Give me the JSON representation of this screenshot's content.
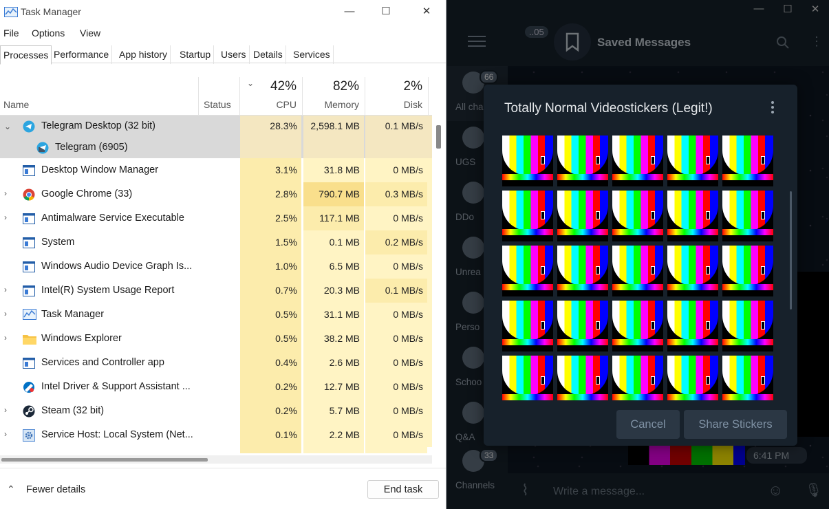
{
  "task_manager": {
    "title": "Task Manager",
    "window_buttons": [
      "—",
      "☐",
      "✕"
    ],
    "menu": [
      "File",
      "Options",
      "View"
    ],
    "tabs": [
      "Processes",
      "Performance",
      "App history",
      "Startup",
      "Users",
      "Details",
      "Services"
    ],
    "columns": {
      "name": "Name",
      "status": "Status",
      "cpu_pct": "42%",
      "cpu": "CPU",
      "mem_pct": "82%",
      "mem": "Memory",
      "disk_pct": "2%",
      "disk": "Disk"
    },
    "rows": [
      {
        "name": "Telegram Desktop (32 bit)",
        "cpu": "28.3%",
        "mem": "2,598.1 MB",
        "disk": "0.1 MB/s",
        "expand": "⌄",
        "icon": "telegram-icon"
      },
      {
        "name": "Telegram (6905)",
        "cpu": "",
        "mem": "",
        "disk": "",
        "expand": "",
        "icon": "telegram-child-icon"
      },
      {
        "name": "Desktop Window Manager",
        "cpu": "3.1%",
        "mem": "31.8 MB",
        "disk": "0 MB/s",
        "expand": "",
        "icon": "app-window-icon"
      },
      {
        "name": "Google Chrome (33)",
        "cpu": "2.8%",
        "mem": "790.7 MB",
        "disk": "0.3 MB/s",
        "expand": "›",
        "icon": "chrome-icon"
      },
      {
        "name": "Antimalware Service Executable",
        "cpu": "2.5%",
        "mem": "117.1 MB",
        "disk": "0 MB/s",
        "expand": "›",
        "icon": "app-window-icon"
      },
      {
        "name": "System",
        "cpu": "1.5%",
        "mem": "0.1 MB",
        "disk": "0.2 MB/s",
        "expand": "",
        "icon": "app-window-icon"
      },
      {
        "name": "Windows Audio Device Graph Is...",
        "cpu": "1.0%",
        "mem": "6.5 MB",
        "disk": "0 MB/s",
        "expand": "",
        "icon": "app-window-icon"
      },
      {
        "name": "Intel(R) System Usage Report",
        "cpu": "0.7%",
        "mem": "20.3 MB",
        "disk": "0.1 MB/s",
        "expand": "›",
        "icon": "app-window-icon"
      },
      {
        "name": "Task Manager",
        "cpu": "0.5%",
        "mem": "31.1 MB",
        "disk": "0 MB/s",
        "expand": "›",
        "icon": "task-manager-icon"
      },
      {
        "name": "Windows Explorer",
        "cpu": "0.5%",
        "mem": "38.2 MB",
        "disk": "0 MB/s",
        "expand": "›",
        "icon": "folder-icon"
      },
      {
        "name": "Services and Controller app",
        "cpu": "0.4%",
        "mem": "2.6 MB",
        "disk": "0 MB/s",
        "expand": "",
        "icon": "app-window-icon"
      },
      {
        "name": "Intel Driver & Support Assistant ...",
        "cpu": "0.2%",
        "mem": "12.7 MB",
        "disk": "0 MB/s",
        "expand": "",
        "icon": "intel-icon"
      },
      {
        "name": "Steam (32 bit)",
        "cpu": "0.2%",
        "mem": "5.7 MB",
        "disk": "0 MB/s",
        "expand": "›",
        "icon": "steam-icon"
      },
      {
        "name": "Service Host: Local System (Net...",
        "cpu": "0.1%",
        "mem": "2.2 MB",
        "disk": "0 MB/s",
        "expand": "›",
        "icon": "gear-icon"
      }
    ],
    "footer": {
      "fewer": "Fewer details",
      "chevron": "⌃",
      "end_task": "End task"
    }
  },
  "telegram": {
    "window_buttons": [
      "—",
      "☐",
      "✕"
    ],
    "back_badge": "..05",
    "chat_title": "Saved Messages",
    "sidebar": [
      {
        "label": "All cha",
        "badge": "66"
      },
      {
        "label": "UGS",
        "badge": ""
      },
      {
        "label": "DDo",
        "badge": ""
      },
      {
        "label": "Unrea",
        "badge": ""
      },
      {
        "label": "Perso",
        "badge": ""
      },
      {
        "label": "Schoo",
        "badge": ""
      },
      {
        "label": "Q&A",
        "badge": ""
      },
      {
        "label": "Channels",
        "badge": "33"
      }
    ],
    "input_placeholder": "Write a message...",
    "message_time": "6:41 PM",
    "dialog": {
      "title": "Totally Normal Videostickers (Legit!)",
      "cancel": "Cancel",
      "share": "Share Stickers",
      "sticker_count": 25
    }
  },
  "colors": {
    "tm_heat_light": "#fff4c4",
    "tm_heat_mid": "#fcecac",
    "tm_heat_high": "#f9df8c",
    "tg_bg": "#17212b",
    "tg_dialog_btn": "#2b3744"
  }
}
